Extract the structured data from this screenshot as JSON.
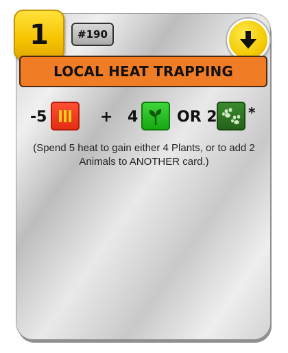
{
  "card": {
    "cost": "1",
    "number": "#190",
    "title": "LOCAL HEAT TRAPPING",
    "event_icon": "down-arrow-icon"
  },
  "effect": {
    "heat_amount": "-5",
    "plus": "+",
    "plant_amount": "4",
    "or_text": "OR 2",
    "asterisk": "*",
    "icons": [
      "heat-resource-icon",
      "plant-resource-icon",
      "animal-resource-icon"
    ]
  },
  "description": "(Spend 5 heat to gain either 4 Plants, or to add 2 Animals to ANOTHER card.)",
  "colors": {
    "title_bar": "#f07c25",
    "cost_badge": "#f6c400",
    "heat_tile": "#e32d14",
    "plant_tile": "#17a812",
    "animal_tile": "#23621a"
  }
}
